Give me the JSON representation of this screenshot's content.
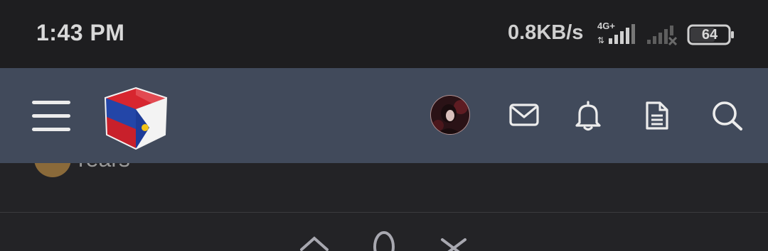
{
  "status_bar": {
    "time": "1:43 PM",
    "network_speed": "0.8KB/s",
    "network_type": "4G+",
    "battery_level": "64",
    "icons": [
      "signal-strength-icon",
      "no-signal-icon",
      "battery-icon"
    ]
  },
  "header": {
    "icons": [
      "menu-icon",
      "app-logo",
      "user-avatar",
      "mail-icon",
      "bell-icon",
      "document-icon",
      "search-icon"
    ],
    "colors": {
      "bar": "#414a5b",
      "icon": "#e8e8e8"
    }
  },
  "content": {
    "peek_item_text": "rears"
  },
  "bottom_controls": {
    "icons": [
      "chevron-up-icon",
      "zero-glyph",
      "close-icon"
    ]
  }
}
